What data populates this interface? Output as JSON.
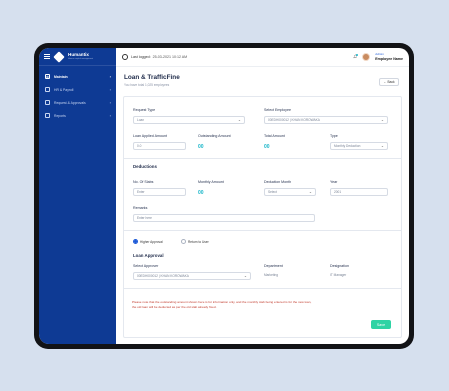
{
  "app": {
    "name": "Humantix",
    "tagline": "Human capital management"
  },
  "sidebar": {
    "items": [
      {
        "label": "Maintain",
        "icon": "gear-icon"
      },
      {
        "label": "HR & Payroll",
        "icon": "people-icon"
      },
      {
        "label": "Request & Approvals",
        "icon": "clipboard-icon"
      },
      {
        "label": "Reports",
        "icon": "chart-icon"
      }
    ]
  },
  "topbar": {
    "last_logged_label": "Last logged:",
    "last_logged_value": "25-03-2021 10:12 AM",
    "user_role": "Admin",
    "user_name": "Employee Name"
  },
  "page": {
    "title": "Loan & TrafficFine",
    "subtitle": "You have total 1,025 employees",
    "back_label": "Back"
  },
  "form": {
    "request_type": {
      "label": "Request Type",
      "value": "Loan"
    },
    "select_employee": {
      "label": "Select Employee",
      "value": "00EDH000012 | KHAN KOROWAKA"
    },
    "loan_applied_amount": {
      "label": "Loan Applied Amount",
      "value": "0.0"
    },
    "outstanding_amount": {
      "label": "Outstanding Amount",
      "value": "00"
    },
    "total_amount": {
      "label": "Total Amount",
      "value": "00"
    },
    "type": {
      "label": "Type",
      "value": "Monthly Deduction"
    },
    "deductions_title": "Deductions",
    "no_of_slabs": {
      "label": "No. Of Slabs",
      "placeholder": "Enter"
    },
    "monthly_amount": {
      "label": "Monthly Amount",
      "value": "00"
    },
    "deduction_month": {
      "label": "Deduction Month",
      "value": "Select"
    },
    "year": {
      "label": "Year",
      "value": "2001"
    },
    "remarks": {
      "label": "Remarks",
      "placeholder": "Enter here"
    },
    "radio_higher": "Higher Approval",
    "radio_return": "Return to User",
    "loan_approval_title": "Loan Approval",
    "select_approver": {
      "label": "Select Approver",
      "value": "00EDH000012 | KHAN KOROWAKA"
    },
    "department": {
      "label": "Department",
      "value": "Marketing"
    },
    "designation": {
      "label": "Designation",
      "value": "IT Manager"
    },
    "note_line1": "Please note that the outstanding amount shown here is for information only, and the monthly slab being entered is for the new loan,",
    "note_line2": "the old loan will be deducted as per the old slab already fixed.",
    "save_label": "Save"
  }
}
